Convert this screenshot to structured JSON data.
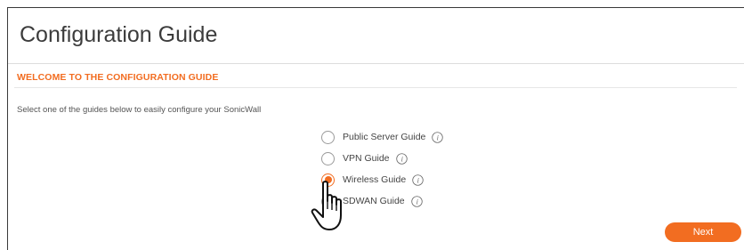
{
  "page": {
    "title": "Configuration Guide"
  },
  "section": {
    "heading": "WELCOME TO THE CONFIGURATION GUIDE",
    "intro": "Select one of the guides below to easily configure your SonicWall"
  },
  "guides": [
    {
      "label": "Public Server Guide",
      "selected": false
    },
    {
      "label": "VPN Guide",
      "selected": false
    },
    {
      "label": "Wireless Guide",
      "selected": true
    },
    {
      "label": "SDWAN Guide",
      "selected": false
    }
  ],
  "actions": {
    "next_label": "Next"
  },
  "icons": {
    "info": "info-icon",
    "cursor": "hand-pointer-cursor"
  },
  "colors": {
    "accent": "#f26d21",
    "title_text": "#3c3c3c",
    "body_text": "#555555"
  }
}
